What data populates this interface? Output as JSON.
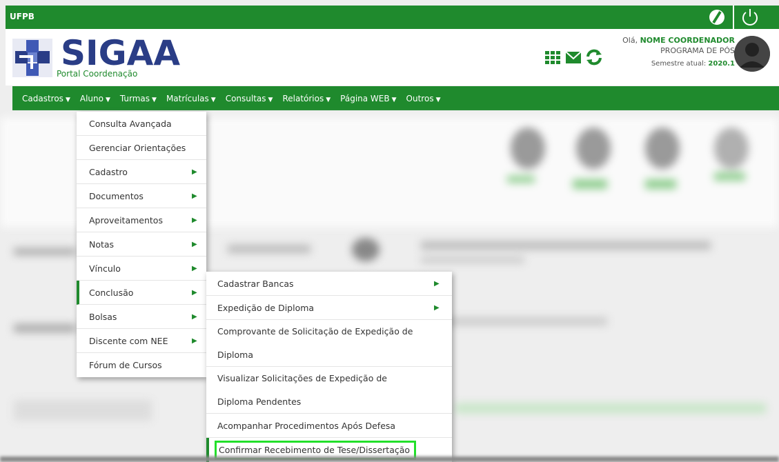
{
  "topbar": {
    "institution": "UFPB"
  },
  "header": {
    "logo_text": "SIGAA",
    "logo_sub": "Portal Coordenação",
    "greeting_prefix": "Olá, ",
    "user_name": "NOME COORDENADOR",
    "program": "PROGRAMA DE PÓS",
    "semester_label": "Semestre atual: ",
    "semester_value": "2020.1"
  },
  "menubar": [
    {
      "label": "Cadastros"
    },
    {
      "label": "Aluno"
    },
    {
      "label": "Turmas"
    },
    {
      "label": "Matrículas"
    },
    {
      "label": "Consultas"
    },
    {
      "label": "Relatórios"
    },
    {
      "label": "Página WEB"
    },
    {
      "label": "Outros"
    }
  ],
  "aluno_menu": [
    {
      "label": "Consulta Avançada"
    },
    {
      "label": "Gerenciar Orientações"
    },
    {
      "label": "Cadastro"
    },
    {
      "label": "Documentos"
    },
    {
      "label": "Aproveitamentos"
    },
    {
      "label": "Notas"
    },
    {
      "label": "Vínculo"
    },
    {
      "label": "Conclusão"
    },
    {
      "label": "Bolsas"
    },
    {
      "label": "Discente com NEE"
    },
    {
      "label": "Fórum de Cursos"
    }
  ],
  "conclusao_menu": [
    {
      "label": "Cadastrar Bancas"
    },
    {
      "label": "Expedição de Diploma"
    },
    {
      "label": "Comprovante de Solicitação de Expedição de Diploma"
    },
    {
      "label": "Visualizar Solicitações de Expedição de Diploma Pendentes"
    },
    {
      "label": "Acompanhar Procedimentos Após Defesa"
    },
    {
      "label": "Confirmar Recebimento de Tese/Dissertação"
    }
  ],
  "colors": {
    "primary_green": "#1f8a2d",
    "logo_blue": "#2a3d86",
    "highlight_green": "#22e02a"
  }
}
